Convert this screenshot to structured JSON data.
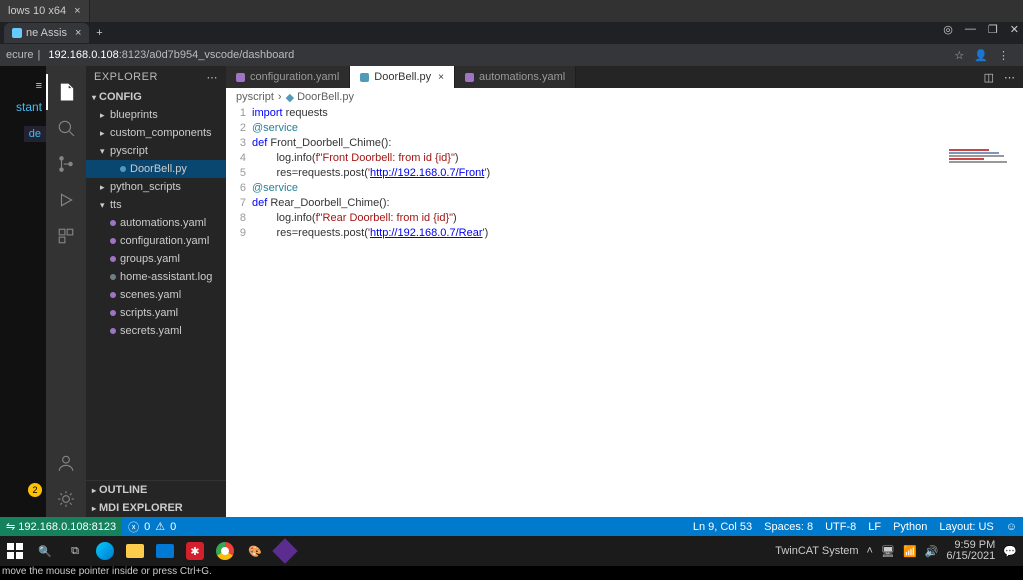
{
  "vm_tab": "lows 10 x64",
  "browser": {
    "tab_title": "ne Assis",
    "secure_label": "ecure",
    "addr_host": "192.168.0.108",
    "addr_path": ":8123/a0d7b954_vscode/dashboard"
  },
  "left": {
    "title": "stant",
    "badge": "2",
    "item": "de"
  },
  "side_title": "EXPLORER",
  "tree": {
    "root": "CONFIG",
    "items": [
      {
        "t": "blueprints",
        "chev": ">",
        "ind": 1
      },
      {
        "t": "custom_components",
        "chev": ">",
        "ind": 1
      },
      {
        "t": "pyscript",
        "chev": "v",
        "ind": 1
      },
      {
        "t": "DoorBell.py",
        "sel": true,
        "dot": "#519aba",
        "ind": 2
      },
      {
        "t": "python_scripts",
        "chev": ">",
        "ind": 1
      },
      {
        "t": "tts",
        "chev": "v",
        "ind": 1
      },
      {
        "t": "automations.yaml",
        "dot": "#a074c4",
        "ind": 1
      },
      {
        "t": "configuration.yaml",
        "dot": "#a074c4",
        "ind": 1
      },
      {
        "t": "groups.yaml",
        "dot": "#a074c4",
        "ind": 1
      },
      {
        "t": "home-assistant.log",
        "dot": "#6d8086",
        "ind": 1
      },
      {
        "t": "scenes.yaml",
        "dot": "#a074c4",
        "ind": 1
      },
      {
        "t": "scripts.yaml",
        "dot": "#a074c4",
        "ind": 1
      },
      {
        "t": "secrets.yaml",
        "dot": "#a074c4",
        "ind": 1
      }
    ],
    "outline": "OUTLINE",
    "mdi": "MDI EXPLORER"
  },
  "tabs": [
    {
      "t": "configuration.yaml",
      "c": "#a074c4"
    },
    {
      "t": "DoorBell.py",
      "c": "#519aba",
      "active": true,
      "close": "×"
    },
    {
      "t": "automations.yaml",
      "c": "#a074c4"
    }
  ],
  "crumbs": [
    "pyscript",
    "DoorBell.py"
  ],
  "code": {
    "nums": [
      "1",
      "2",
      "3",
      "4",
      "5",
      "6",
      "7",
      "8",
      "9"
    ],
    "l1a": "import",
    "l1b": " requests",
    "l2": "@service",
    "l3a": "def",
    "l3b": " Front_Doorbell_Chime():",
    "l4a": "        log.info(",
    "l4b": "f\"Front Doorbell: from id {id}\"",
    "l4c": ")",
    "l5a": "        res=requests.post(",
    "l5b": "'",
    "l5c": "http://192.168.0.7/Front",
    "l5d": "'",
    "l5e": ")",
    "l6": "@service",
    "l7a": "def",
    "l7b": " Rear_Doorbell_Chime():",
    "l8a": "        log.info(",
    "l8b": "f\"Rear Doorbell: from id {id}\"",
    "l8c": ")",
    "l9a": "        res=requests.post(",
    "l9b": "'",
    "l9c": "http://192.168.0.7/Rear",
    "l9d": "'",
    "l9e": ")"
  },
  "status": {
    "remote_host": "192.168.0.108:8123",
    "errors": "0",
    "warnings": "0",
    "ln_col": "Ln 9, Col 53",
    "spaces": "Spaces: 8",
    "enc": "UTF-8",
    "eol": "LF",
    "lang": "Python",
    "layout": "Layout: US"
  },
  "tray": {
    "twincat": "TwinCAT System",
    "time": "9:59 PM",
    "date": "6/15/2021"
  },
  "footnote": "move the mouse pointer inside or press Ctrl+G."
}
